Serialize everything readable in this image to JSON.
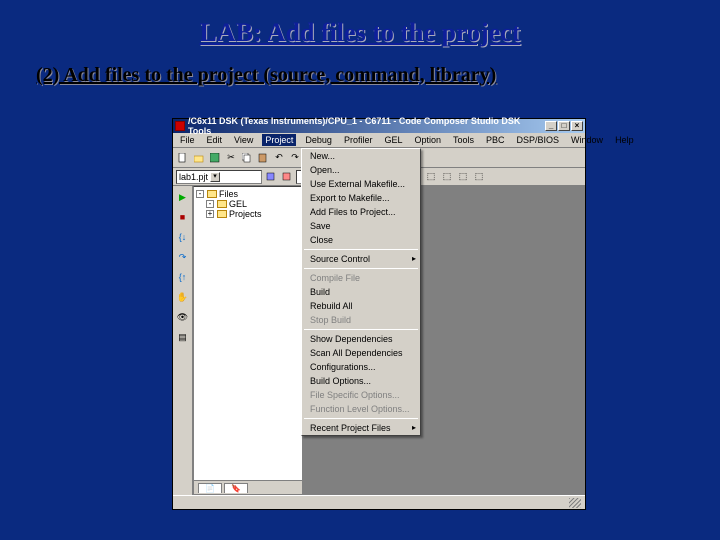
{
  "slide": {
    "title": "LAB: Add files to the project",
    "subtitle": "(2) Add files to the project (source, command, library)"
  },
  "window": {
    "title": "/C6x11 DSK (Texas Instruments)/CPU_1 - C6711 - Code Composer Studio DSK Tools",
    "controls": {
      "min": "_",
      "max": "□",
      "close": "×"
    }
  },
  "menubar": {
    "items": [
      "File",
      "Edit",
      "View",
      "Project",
      "Debug",
      "Profiler",
      "GEL",
      "Option",
      "Tools",
      "PBC",
      "DSP/BIOS",
      "Window",
      "Help"
    ],
    "active_index": 3
  },
  "toolbar": {
    "project_combo": "lab1.pjt"
  },
  "project_tree": {
    "tab": "Files",
    "rows": [
      {
        "exp": "-",
        "label": "Files"
      },
      {
        "exp": "-",
        "label": "GEL"
      },
      {
        "exp": "+",
        "label": "Projects"
      }
    ]
  },
  "project_menu": {
    "g1": [
      "New...",
      "Open...",
      "Use External Makefile...",
      "Export to Makefile...",
      "Add Files to Project...",
      "Save",
      "Close"
    ],
    "g2": [
      "Source Control"
    ],
    "g3": [
      "Compile File",
      "Build",
      "Rebuild All",
      "Stop Build"
    ],
    "g4": [
      "Show Dependencies",
      "Scan All Dependencies",
      "Configurations...",
      "Build Options...",
      "File Specific Options...",
      "Function Level Options..."
    ],
    "g5": [
      "Recent Project Files"
    ]
  }
}
